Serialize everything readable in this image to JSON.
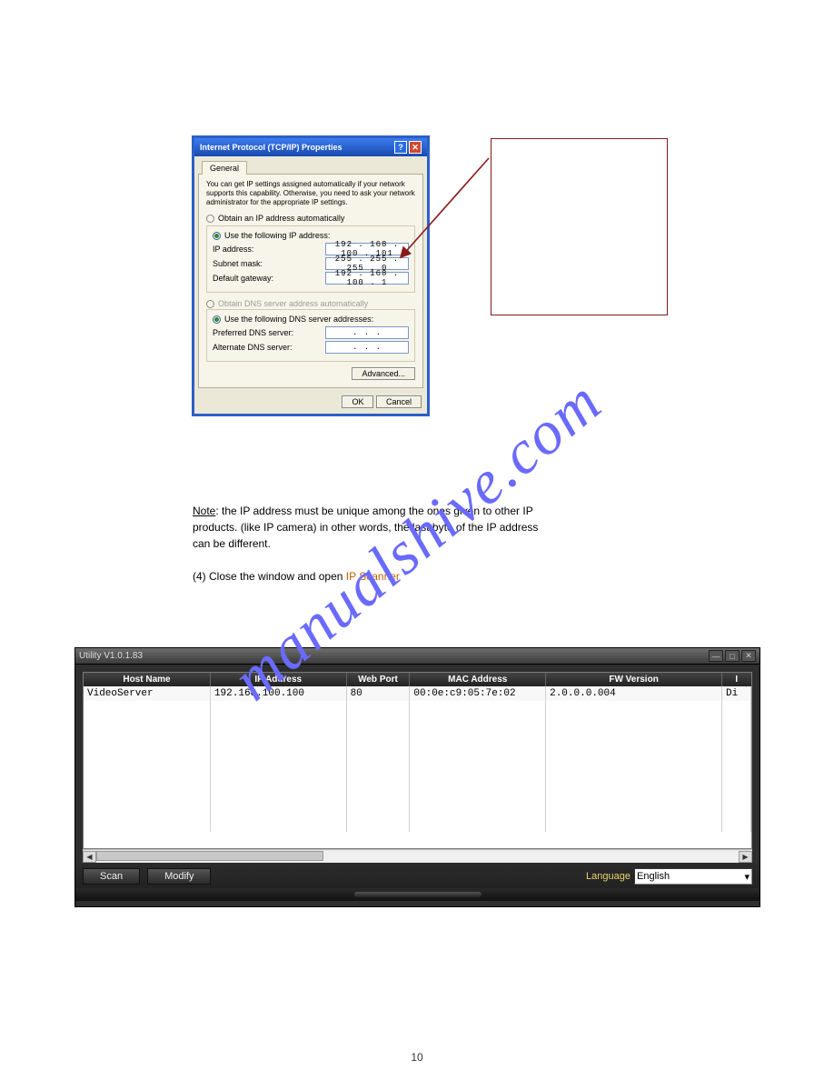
{
  "watermark": "manualshive.com",
  "tcpip": {
    "title": "Internet Protocol (TCP/IP) Properties",
    "tab": "General",
    "help_text": "You can get IP settings assigned automatically if your network supports this capability. Otherwise, you need to ask your network administrator for the appropriate IP settings.",
    "auto_ip": "Obtain an IP address automatically",
    "use_ip": "Use the following IP address:",
    "ip_label": "IP address:",
    "ip_value": "192 . 168 . 100 . 101",
    "subnet_label": "Subnet mask:",
    "subnet_value": "255 . 255 . 255 .  0",
    "gateway_label": "Default gateway:",
    "gateway_value": "192 . 168 . 100 .  1",
    "auto_dns": "Obtain DNS server address automatically",
    "use_dns": "Use the following DNS server addresses:",
    "pref_dns_label": "Preferred DNS server:",
    "pref_dns_value": ".       .       .",
    "alt_dns_label": "Alternate DNS server:",
    "alt_dns_value": ".       .       .",
    "advanced": "Advanced...",
    "ok": "OK",
    "cancel": "Cancel"
  },
  "mid_text": {
    "note_label": "Note",
    "note_after": ": the IP address must be unique among the ones given to other IP",
    "line2": "products. (like IP camera) in other words, the last byte of the IP address",
    "line3": "can be different.",
    "step_prefix": "(4) Close the window and open ",
    "step_link": "IP Scanner"
  },
  "utility": {
    "title": "Utility V1.0.1.83",
    "headers": [
      "Host Name",
      "IP Address",
      "Web Port",
      "MAC Address",
      "FW Version",
      "I"
    ],
    "row": {
      "host": "VideoServer",
      "ip": "192.168.100.100",
      "port": "80",
      "mac": "00:0e:c9:05:7e:02",
      "fw": "2.0.0.0.004",
      "trail": "Di"
    },
    "scan": "Scan",
    "modify": "Modify",
    "language_label": "Language",
    "language_value": "English"
  },
  "page_number": "10"
}
